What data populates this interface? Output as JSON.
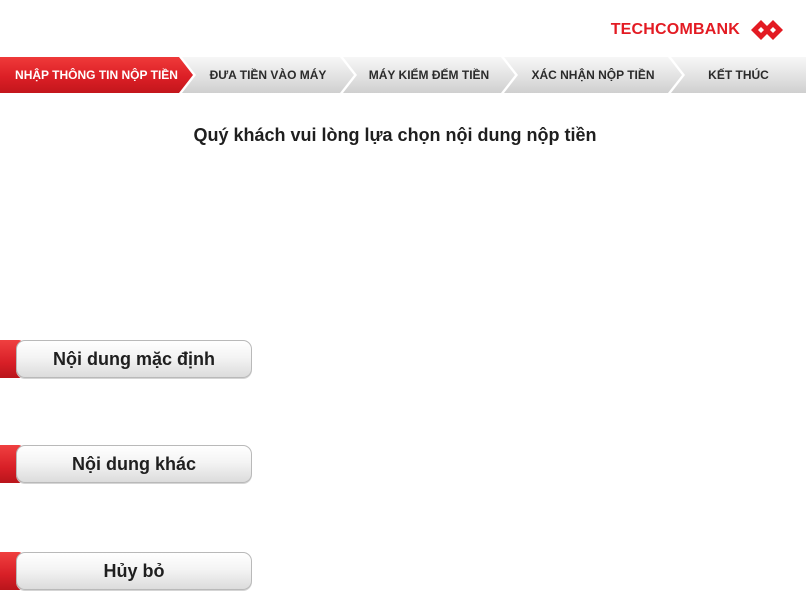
{
  "brand": {
    "name": "TECHCOMBANK",
    "color": "#e31b23",
    "logo_icon": "techcombank-diamond-logo"
  },
  "steps": [
    {
      "label": "NHẬP THÔNG TIN NỘP TIỀN",
      "active": true
    },
    {
      "label": "ĐƯA TIỀN VÀO MÁY",
      "active": false
    },
    {
      "label": "MÁY KIỂM ĐẾM TIỀN",
      "active": false
    },
    {
      "label": "XÁC NHẬN NỘP TIỀN",
      "active": false
    },
    {
      "label": "KẾT THÚC",
      "active": false
    }
  ],
  "prompt": "Quý khách vui lòng lựa chọn nội dung nộp tiền",
  "options": [
    {
      "label": "Nội dung mặc định"
    },
    {
      "label": "Nội dung khác"
    },
    {
      "label": "Hủy bỏ"
    }
  ],
  "colors": {
    "accent": "#dc1f26",
    "step_inactive": "#e2e2e2"
  }
}
